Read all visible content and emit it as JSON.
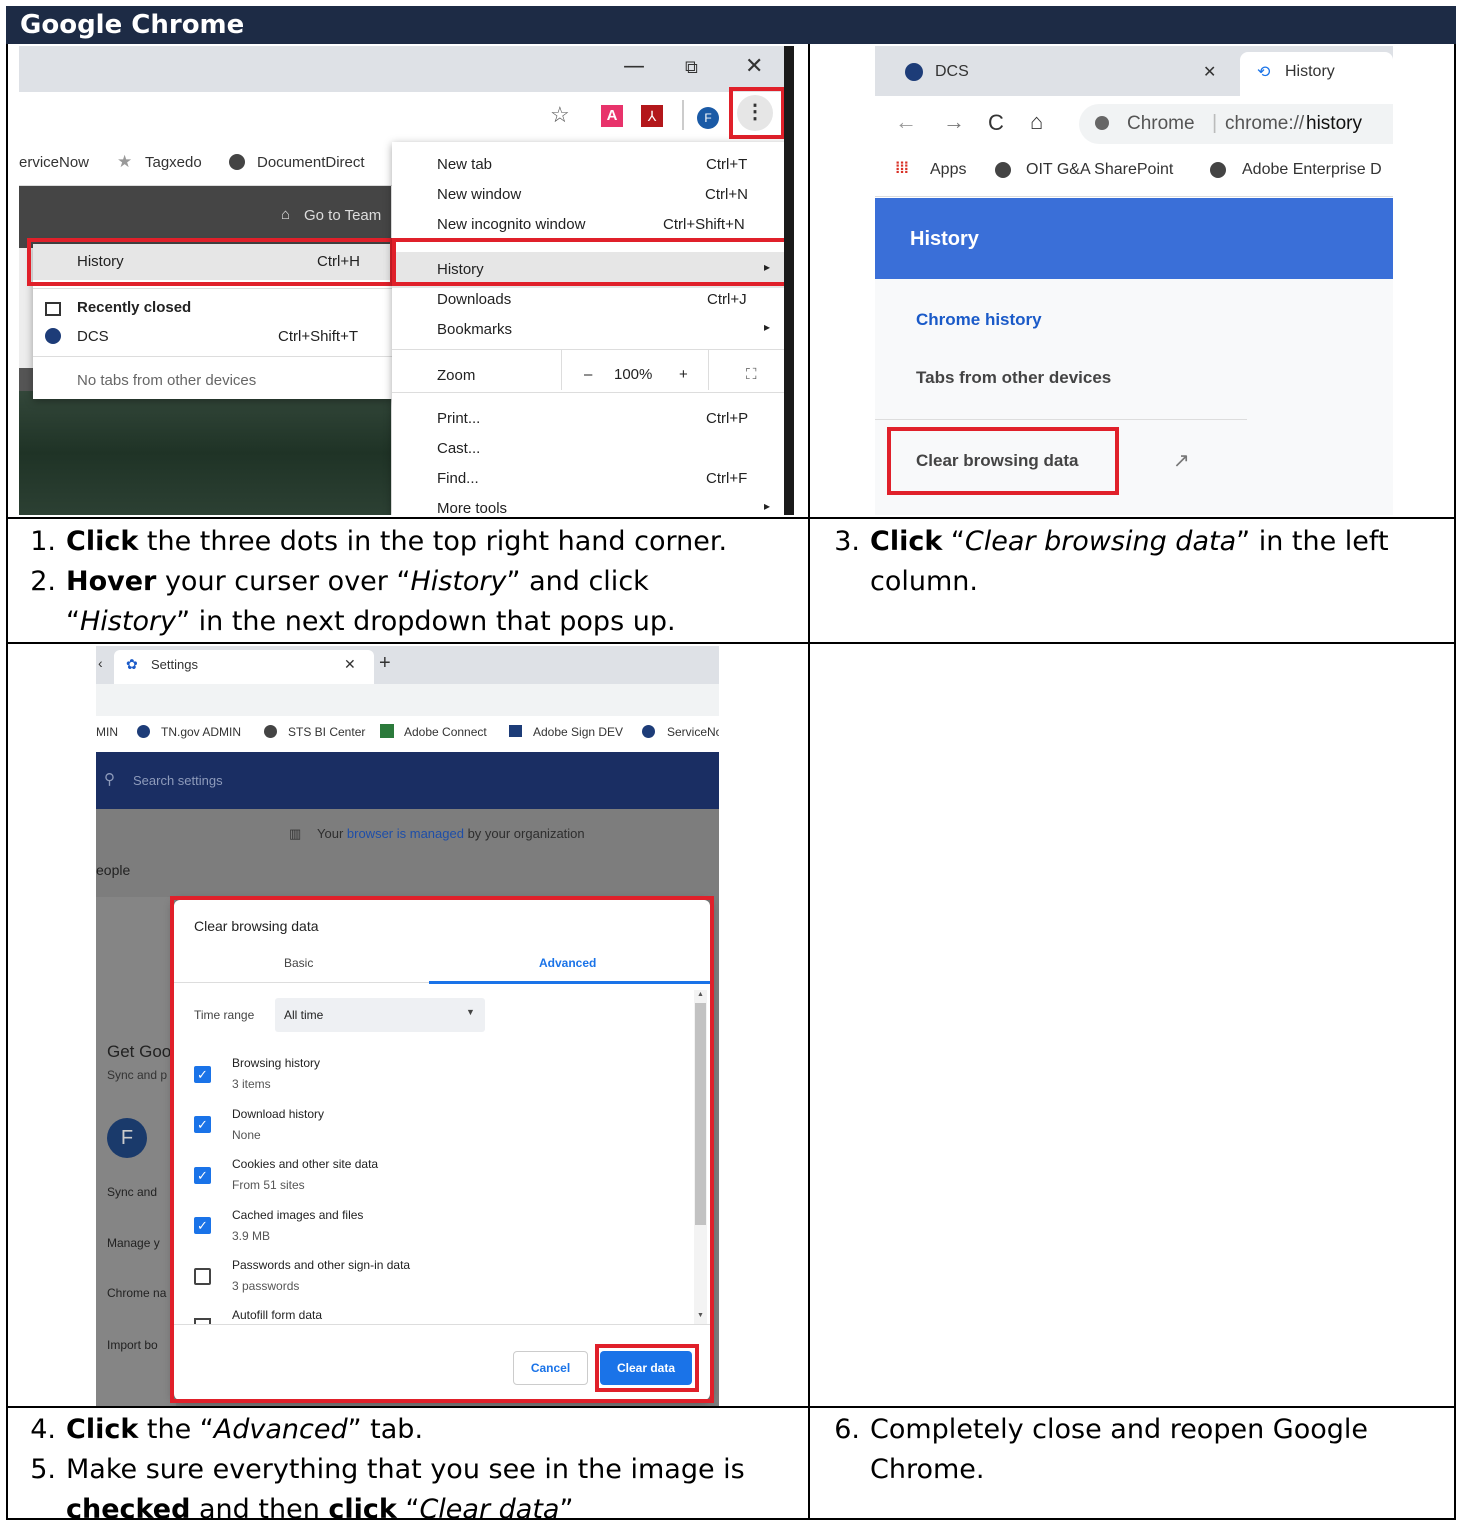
{
  "header": {
    "title": "Google Chrome"
  },
  "step1": {
    "line1_num": "1.",
    "line1_bold": "Click",
    "line1_rest": " the three dots in the top right hand corner.",
    "line2_num": "2.",
    "line2_bold": "Hover",
    "line2_rest1": " your curser over “",
    "line2_it1": "History",
    "line2_rest2": "” and click",
    "line3_q1": "“",
    "line3_it": "History",
    "line3_rest": "” in the next dropdown that pops up."
  },
  "step3": {
    "num": "3.",
    "bold": "Click",
    "q1": " “",
    "it": "Clear browsing data",
    "rest": "” in the left",
    "line2": "column."
  },
  "step4": {
    "num": "4.",
    "bold": "Click",
    "rest1": " the “",
    "it": "Advanced",
    "rest2": "” tab."
  },
  "step5": {
    "num": "5.",
    "line1": "Make sure everything that you see in the image is",
    "bold1": "checked",
    "mid": " and then ",
    "bold2": "click",
    "q": " “",
    "it": "Clear data",
    "q2": "”"
  },
  "step6": {
    "num": "6.",
    "line1": "Completely close and reopen Google",
    "line2": "Chrome."
  },
  "panel1": {
    "win_min": "—",
    "win_restore": "⧉",
    "win_close": "✕",
    "bookmarks": [
      "erviceNow",
      "Tagxedo",
      "DocumentDirect"
    ],
    "site_text": "Go to Team",
    "menu": [
      {
        "label": "New tab",
        "shortcut": "Ctrl+T"
      },
      {
        "label": "New window",
        "shortcut": "Ctrl+N"
      },
      {
        "label": "New incognito window",
        "shortcut": "Ctrl+Shift+N"
      },
      {
        "label": "History",
        "shortcut": ""
      },
      {
        "label": "Downloads",
        "shortcut": "Ctrl+J"
      },
      {
        "label": "Bookmarks",
        "shortcut": ""
      },
      {
        "label": "Zoom",
        "shortcut": ""
      },
      {
        "label": "Print...",
        "shortcut": "Ctrl+P"
      },
      {
        "label": "Cast...",
        "shortcut": ""
      },
      {
        "label": "Find...",
        "shortcut": "Ctrl+F"
      },
      {
        "label": "More tools",
        "shortcut": ""
      }
    ],
    "zoom": {
      "minus": "–",
      "value": "100%",
      "plus": "+"
    },
    "submenu": {
      "history": "History",
      "history_sc": "Ctrl+H",
      "recently_closed": "Recently closed",
      "dcs": "DCS",
      "dcs_sc": "Ctrl+Shift+T",
      "no_tabs": "No tabs from other devices"
    }
  },
  "panel2": {
    "tab1": "DCS",
    "tab2": "History",
    "omni_label": "Chrome",
    "omni_url_plain": "chrome://",
    "omni_url_bold": "history",
    "bookmarks": [
      "Apps",
      "OIT G&A SharePoint",
      "Adobe Enterprise D"
    ],
    "banner": "History",
    "nav1": "Chrome history",
    "nav2": "Tabs from other devices",
    "clear": "Clear browsing data"
  },
  "panel3": {
    "tab": "Settings",
    "bookmarks": [
      "MIN",
      "TN.gov ADMIN",
      "STS BI Center",
      "Adobe Connect",
      "Adobe Sign DEV",
      "ServiceNo"
    ],
    "search_placeholder": "Search settings",
    "managed_pre": "Your ",
    "managed_link": "browser is managed",
    "managed_post": " by your organization",
    "people": "eople",
    "bg_items": [
      "Get Goo",
      "Sync and p",
      "Sync and",
      "Manage y",
      "Chrome na",
      "Import bo"
    ],
    "avatar": "F",
    "dialog_title": "Clear browsing data",
    "tab_basic": "Basic",
    "tab_advanced": "Advanced",
    "time_range_label": "Time range",
    "time_range_value": "All time",
    "items": [
      {
        "title": "Browsing history",
        "sub": "3 items",
        "checked": true
      },
      {
        "title": "Download history",
        "sub": "None",
        "checked": true
      },
      {
        "title": "Cookies and other site data",
        "sub": "From 51 sites",
        "checked": true
      },
      {
        "title": "Cached images and files",
        "sub": "3.9 MB",
        "checked": true
      },
      {
        "title": "Passwords and other sign-in data",
        "sub": "3 passwords",
        "checked": false
      },
      {
        "title": "Autofill form data",
        "sub": "",
        "checked": false
      }
    ],
    "cancel": "Cancel",
    "clear": "Clear data"
  }
}
